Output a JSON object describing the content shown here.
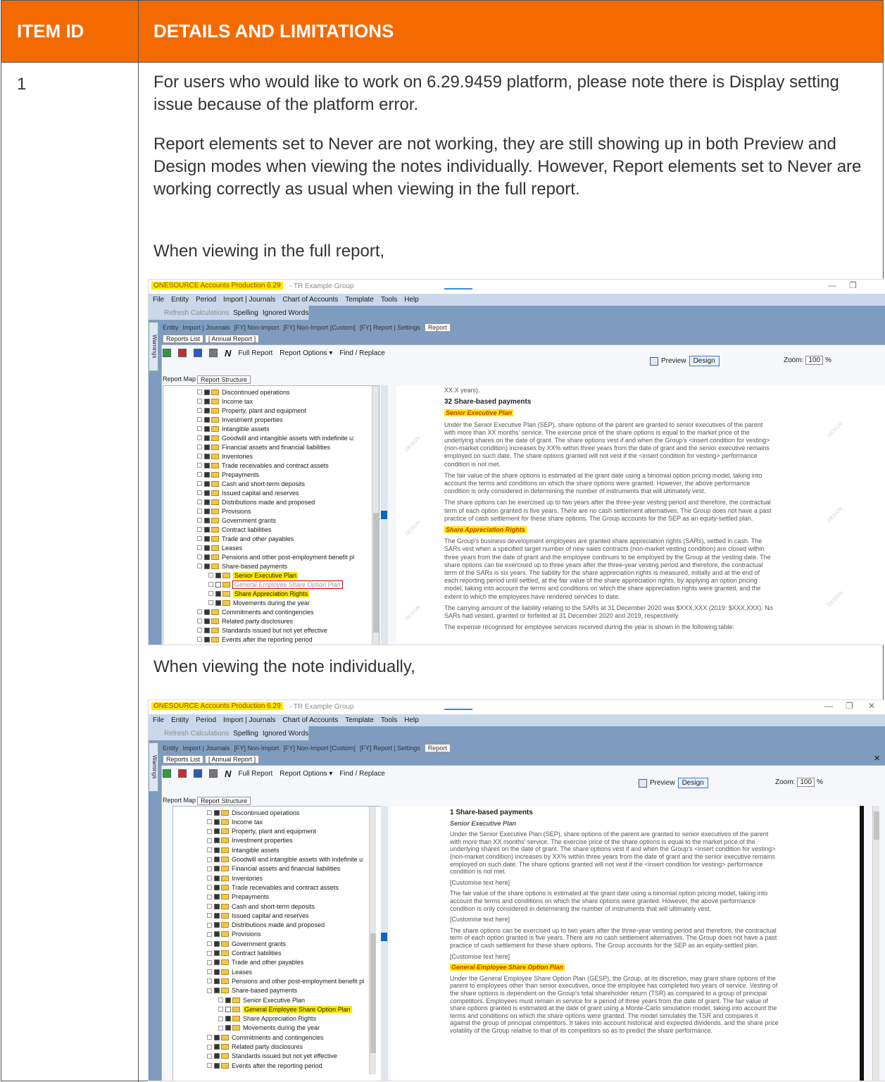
{
  "table": {
    "col1_header": "ITEM ID",
    "col2_header": "DETAILS AND LIMITATIONS",
    "row": {
      "item_id": "1",
      "para1": "For users who would like to work on 6.29.9459 platform, please note there is Display setting issue because of the platform error.",
      "para2": "Report elements set to Never are not working, they are still showing up in both Preview and Design modes when viewing the notes individually. However, Report elements set to Never are working correctly as usual when viewing in the full report.",
      "caption1": "When viewing in the full report,",
      "caption2": "When viewing the note individually,"
    }
  },
  "app": {
    "title_highlight": "ONESOURCE Accounts Production 6.29",
    "title_rest": "- TR Example Group",
    "menu": [
      "File",
      "Entity",
      "Period",
      "Import | Journals",
      "Chart of Accounts",
      "Template",
      "Tools",
      "Help"
    ],
    "toolbar": {
      "refresh": "Refresh Calculations",
      "spelling": "Spelling",
      "ignored": "Ignored Words"
    },
    "warnings_tab": "Warnings",
    "top_tabs": [
      "Entity",
      "Import | Journals",
      "[FY] Non-Import",
      "[FY] Non-Import [Custom]",
      "[FY] Report | Settings",
      "Report"
    ],
    "sub_tabs": [
      "Reports List",
      "[ Annual Report ]"
    ],
    "report_toolbar": {
      "n": "N",
      "full_report": "Full Report",
      "report_options": "Report Options ▾",
      "find_replace": "Find / Replace"
    },
    "preview": "Preview",
    "design": "Design",
    "zoom_label": "Zoom:",
    "zoom_value": "100",
    "zoom_pct": "%",
    "left_tabs": [
      "Report Map",
      "Report Structure"
    ],
    "watermark": "DESIGN"
  },
  "tree1": [
    {
      "label": "Discontinued operations",
      "depth": 0
    },
    {
      "label": "Income tax",
      "depth": 0
    },
    {
      "label": "Property, plant and equipment",
      "depth": 0
    },
    {
      "label": "Investment properties",
      "depth": 0
    },
    {
      "label": "Intangible assets",
      "depth": 0
    },
    {
      "label": "Goodwill and intangible assets with indefinite u:",
      "depth": 0
    },
    {
      "label": "Financial assets and financial liabilities",
      "depth": 0
    },
    {
      "label": "Inventories",
      "depth": 0
    },
    {
      "label": "Trade receivables and contract assets",
      "depth": 0
    },
    {
      "label": "Prepayments",
      "depth": 0
    },
    {
      "label": "Cash and short-term deposits",
      "depth": 0
    },
    {
      "label": "Issued capital and reserves",
      "depth": 0
    },
    {
      "label": "Distributions made and proposed",
      "depth": 0
    },
    {
      "label": "Provisions",
      "depth": 0
    },
    {
      "label": "Government grants",
      "depth": 0
    },
    {
      "label": "Contract liabilities",
      "depth": 0
    },
    {
      "label": "Trade and other payables",
      "depth": 0
    },
    {
      "label": "Leases",
      "depth": 0
    },
    {
      "label": "Pensions and other post-employment benefit pl",
      "depth": 0
    },
    {
      "label": "Share-based payments",
      "depth": 0
    },
    {
      "label": "Senior Executive Plan",
      "depth": 1,
      "style": "hl"
    },
    {
      "label": "General Employee Share Option Plan",
      "depth": 1,
      "style": "boxed",
      "empty": true
    },
    {
      "label": "Share Appreciation Rights",
      "depth": 1,
      "style": "hl"
    },
    {
      "label": "Movements during the year",
      "depth": 1
    },
    {
      "label": "Commitments and contingencies",
      "depth": 0
    },
    {
      "label": "Related party disclosures",
      "depth": 0
    },
    {
      "label": "Standards issued but not yet effective",
      "depth": 0
    },
    {
      "label": "Events after the reporting period",
      "depth": 0
    }
  ],
  "tree2": [
    {
      "label": "Discontinued operations",
      "depth": 0
    },
    {
      "label": "Income tax",
      "depth": 0
    },
    {
      "label": "Property, plant and equipment",
      "depth": 0
    },
    {
      "label": "Investment properties",
      "depth": 0
    },
    {
      "label": "Intangible assets",
      "depth": 0
    },
    {
      "label": "Goodwill and intangible assets with indefinite u",
      "depth": 0
    },
    {
      "label": "Financial assets and financial liabilities",
      "depth": 0
    },
    {
      "label": "Inventories",
      "depth": 0
    },
    {
      "label": "Trade receivables and contract assets",
      "depth": 0
    },
    {
      "label": "Prepayments",
      "depth": 0
    },
    {
      "label": "Cash and short-term deposits",
      "depth": 0
    },
    {
      "label": "Issued capital and reserves",
      "depth": 0
    },
    {
      "label": "Distributions made and proposed",
      "depth": 0
    },
    {
      "label": "Provisions",
      "depth": 0
    },
    {
      "label": "Government grants",
      "depth": 0
    },
    {
      "label": "Contract liabilities",
      "depth": 0
    },
    {
      "label": "Trade and other payables",
      "depth": 0
    },
    {
      "label": "Leases",
      "depth": 0
    },
    {
      "label": "Pensions and other post-employment benefit pl",
      "depth": 0
    },
    {
      "label": "Share-based payments",
      "depth": 0
    },
    {
      "label": "Senior Executive Plan",
      "depth": 1
    },
    {
      "label": "General Employee Share Option Plan",
      "depth": 1,
      "style": "hl",
      "empty": true
    },
    {
      "label": "Share Appreciation Rights",
      "depth": 1
    },
    {
      "label": "Movements during the year",
      "depth": 1
    },
    {
      "label": "Commitments and contingencies",
      "depth": 0
    },
    {
      "label": "Related party disclosures",
      "depth": 0
    },
    {
      "label": "Standards issued but not yet effective",
      "depth": 0
    },
    {
      "label": "Events after the reporting period",
      "depth": 0
    }
  ],
  "doc1": [
    {
      "text": "XX.X years).",
      "kind": "p"
    },
    {
      "text": "32      Share-based payments",
      "kind": "h"
    },
    {
      "text": "Senior Executive Plan",
      "kind": "sub"
    },
    {
      "text": "Under the Senior Executive Plan (SEP), share options of the parent are granted to senior executives of the parent",
      "kind": "p"
    },
    {
      "text": "with more than XX months' service. The exercise price of the share options is equal to the market price of the",
      "kind": "p"
    },
    {
      "text": "underlying shares on the date of grant. The share options vest if and when the Group's <insert condition for vesting>",
      "kind": "p"
    },
    {
      "text": "(non-market condition) increases by XX% within three years from the date of grant and the senior executive remains",
      "kind": "p"
    },
    {
      "text": "employed on such date. The share options granted will not vest if the <insert condition for vesting> performance",
      "kind": "p"
    },
    {
      "text": "condition is not met.",
      "kind": "p"
    },
    {
      "text": "The fair value of the share options is estimated at the grant date using a binomial option pricing model, taking into",
      "kind": "p"
    },
    {
      "text": "account the terms and conditions on which the share options were granted. However, the above performance",
      "kind": "p"
    },
    {
      "text": "condition is only considered in determining the number of instruments that will ultimately vest.",
      "kind": "p"
    },
    {
      "text": "The share options can be exercised up to two years after the three-year vesting period and therefore, the contractual",
      "kind": "p"
    },
    {
      "text": "term of each option granted is five years. There are no cash settlement alternatives. The Group does not have a past",
      "kind": "p"
    },
    {
      "text": "practice of cash settlement for these share options. The Group accounts for the SEP as an equity-settled plan.",
      "kind": "p"
    },
    {
      "text": "Share Appreciation Rights",
      "kind": "sub"
    },
    {
      "text": "The Group's business development employees are granted share appreciation rights (SARs), settled in cash. The",
      "kind": "p"
    },
    {
      "text": "SARs vest when a specified target number of new sales contracts (non-market vesting condition) are closed within",
      "kind": "p"
    },
    {
      "text": "three years from the date of grant and the employee continues to be employed by the Group at the vesting date. The",
      "kind": "p"
    },
    {
      "text": "share options can be exercised up to three years after the three-year vesting period and therefore, the contractual",
      "kind": "p"
    },
    {
      "text": "term of the SARs is six years. The liability for the share appreciation rights is measured, initially and at the end of",
      "kind": "p"
    },
    {
      "text": "each reporting period until settled, at the fair value of the share appreciation rights, by applying an option pricing",
      "kind": "p"
    },
    {
      "text": "model, taking into account the terms and conditions on which the share appreciation rights were granted, and the",
      "kind": "p"
    },
    {
      "text": "extent to which the employees have rendered services to date.",
      "kind": "p"
    },
    {
      "text": "The carrying amount of the liability relating to the SARs at 31 December 2020 was $XXX,XXX (2019: $XXX,XXX). No",
      "kind": "p"
    },
    {
      "text": "SARs had vested, granted or forfeited at 31 December 2020 and 2019, respectively.",
      "kind": "p"
    },
    {
      "text": "The expense recognised for employee services received during the year is shown in the following table:",
      "kind": "p"
    }
  ],
  "doc2": [
    {
      "text": "1        Share-based payments",
      "kind": "h"
    },
    {
      "text": "Senior Executive Plan",
      "kind": "subplain"
    },
    {
      "text": "Under the Senior Executive Plan (SEP), share options of the parent are granted to senior executives of the parent",
      "kind": "p"
    },
    {
      "text": "with more than XX months' service. The exercise price of the share options is equal to the market price of the",
      "kind": "p"
    },
    {
      "text": "underlying shares on the date of grant. The share options vest if and when the Group's <insert condition for vesting>",
      "kind": "p"
    },
    {
      "text": "(non-market condition) increases by XX% within three years from the date of grant and the senior executive remains",
      "kind": "p"
    },
    {
      "text": "employed on such date. The share options granted will not vest if the <insert condition for vesting> performance",
      "kind": "p"
    },
    {
      "text": "condition is not met.",
      "kind": "p"
    },
    {
      "text": "[Customise text here]",
      "kind": "p"
    },
    {
      "text": "The fair value of the share options is estimated at the grant date using a binomial option pricing model, taking into",
      "kind": "p"
    },
    {
      "text": "account the terms and conditions on which the share options were granted. However, the above performance",
      "kind": "p"
    },
    {
      "text": "condition is only considered in determining the number of instruments that will ultimately vest.",
      "kind": "p"
    },
    {
      "text": "[Customise text here]",
      "kind": "p"
    },
    {
      "text": "The share options can be exercised up to two years after the three-year vesting period and therefore, the contractual",
      "kind": "p"
    },
    {
      "text": "term of each option granted is five years. There are no cash settlement alternatives. The Group does not have a past",
      "kind": "p"
    },
    {
      "text": "practice of cash settlement for these share options. The Group accounts for the SEP as an equity-settled plan.",
      "kind": "p"
    },
    {
      "text": "[Customise text here]",
      "kind": "p"
    },
    {
      "text": "General Employee Share Option Plan",
      "kind": "sub"
    },
    {
      "text": "Under the General Employee Share Option Plan (GESP), the Group, at its discretion, may grant share options of the",
      "kind": "p"
    },
    {
      "text": "parent to employees other than senior executives, once the employee has completed two years of service. Vesting of",
      "kind": "p"
    },
    {
      "text": "the share options is dependent on the Group's total shareholder return (TSR) as compared to a group of principal",
      "kind": "p"
    },
    {
      "text": "competitors. Employees must remain in service for a period of three years from the date of grant. The fair value of",
      "kind": "p"
    },
    {
      "text": "share options granted is estimated at the date of grant using a Monte-Carlo simulation model, taking into account the",
      "kind": "p"
    },
    {
      "text": "terms and conditions on which the share options were granted. The model simulates the TSR and compares it",
      "kind": "p"
    },
    {
      "text": "against the group of principal competitors. It takes into account historical and expected dividends, and the share price",
      "kind": "p"
    },
    {
      "text": "volatility of the Group relative to that of its competitors so as to predict the share performance.",
      "kind": "p"
    }
  ]
}
